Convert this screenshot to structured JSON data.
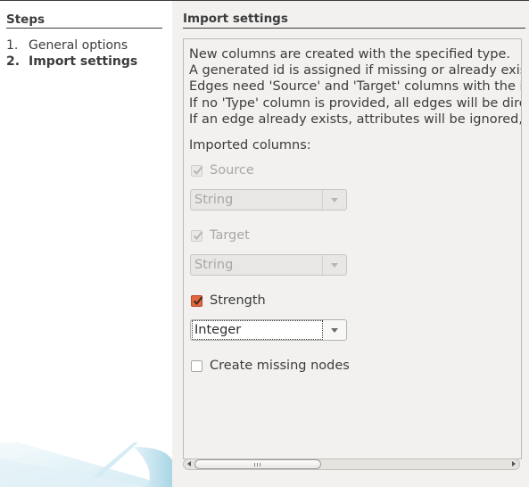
{
  "steps": {
    "title": "Steps",
    "items": [
      {
        "num": "1.",
        "label": "General options",
        "current": false
      },
      {
        "num": "2.",
        "label": "Import settings",
        "current": true
      }
    ]
  },
  "settings": {
    "title": "Import settings",
    "description": [
      "New columns are created with the specified type.",
      "A generated id is assigned if missing or already existing",
      "Edges need 'Source' and 'Target' columns with the id",
      "If no 'Type' column is provided, all edges will be directe",
      "If an edge already exists, attributes will be ignored, bu"
    ],
    "imported_columns_label": "Imported columns:",
    "columns": [
      {
        "name": "Source",
        "checked": true,
        "enabled": false,
        "type": "String"
      },
      {
        "name": "Target",
        "checked": true,
        "enabled": false,
        "type": "String"
      },
      {
        "name": "Strength",
        "checked": true,
        "enabled": true,
        "type": "Integer"
      }
    ],
    "create_missing_nodes": {
      "label": "Create missing nodes",
      "checked": false
    }
  },
  "colors": {
    "accent_checkbox": "#e2663b",
    "background": "#f2f1f0"
  }
}
